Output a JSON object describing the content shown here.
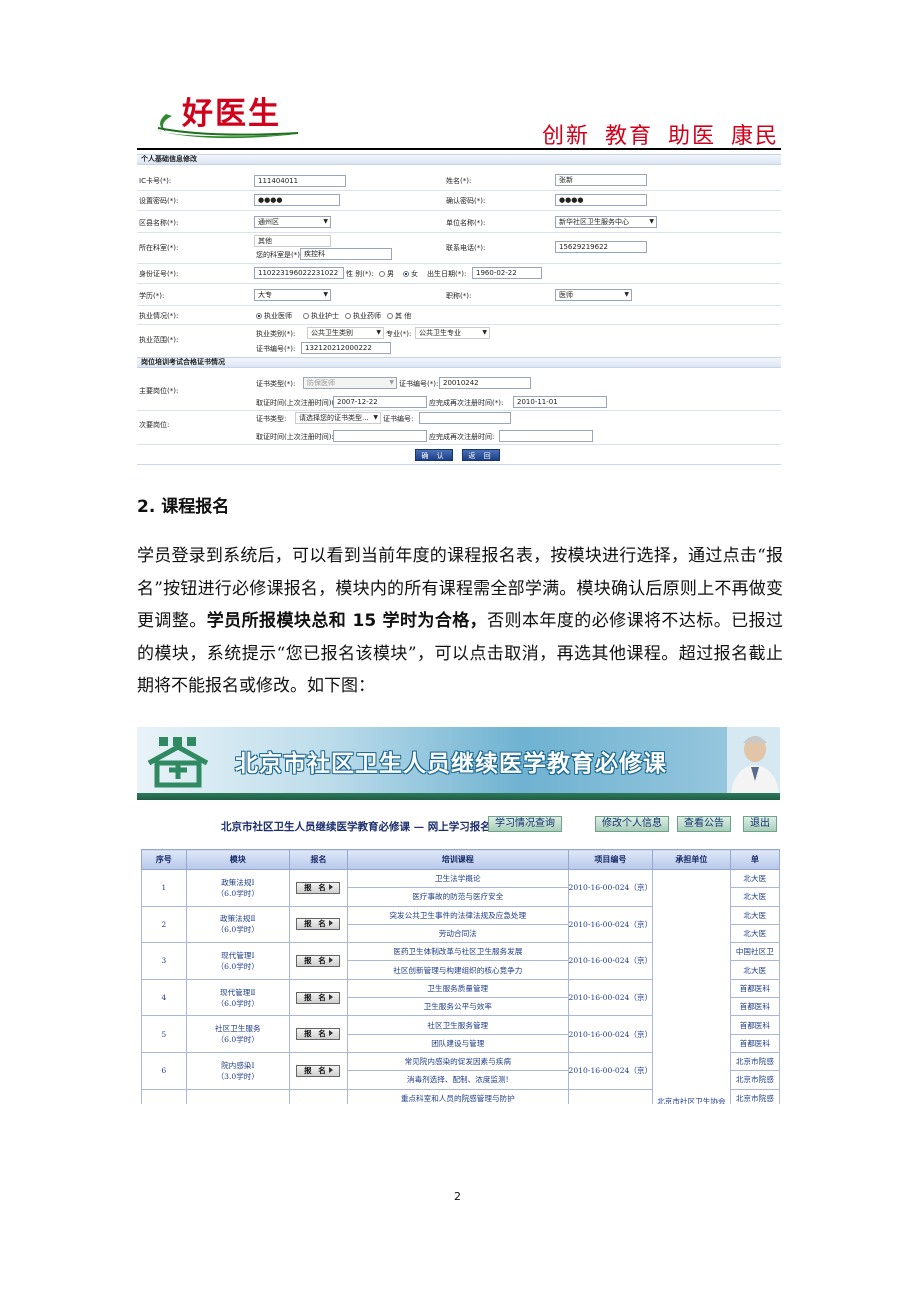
{
  "header": {
    "logo_text": "好医生",
    "slogan": "创新 教育 助医 康民"
  },
  "form": {
    "section1_title": "个人基础信息修改",
    "ic_label": "IC卡号(*):",
    "ic_value": "111404011",
    "name_label": "姓名(*):",
    "name_value": "张新",
    "pwd_label": "设置密码(*):",
    "pwd_value": "●●●●",
    "confirm_label": "确认密码(*):",
    "confirm_value": "●●●●",
    "district_label": "区县名称(*):",
    "district_value": "通州区",
    "unit_label": "单位名称(*):",
    "unit_value": "新华社区卫生服务中心",
    "dept_label": "所在科室(*):",
    "dept_value": "其他",
    "dept_note_label": "您的科室是(*):",
    "dept_note_value": "疾控科",
    "phone_label": "联系电话(*):",
    "phone_value": "15629219622",
    "id_label": "身份证号(*):",
    "id_value": "110223196022231022",
    "gender_label": "性 别(*):",
    "gender_male": "男",
    "gender_female": "女",
    "birth_label": "出生日期(*):",
    "birth_value": "1960-02-22",
    "edu_label": "学历(*):",
    "edu_value": "大专",
    "title_label": "职称(*):",
    "title_value": "医师",
    "practice_label": "执业情况(*):",
    "practice_opts": [
      "执业医师",
      "执业护士",
      "执业药师",
      "其 他"
    ],
    "scope_label": "执业范围(*):",
    "scope_cat_label": "执业类别(*):",
    "scope_cat_value": "公共卫生类别",
    "scope_spec_label": "专业(*):",
    "scope_spec_value": "公共卫生专业",
    "cert_no_label": "证书编号(*):",
    "cert_no_value": "132120212000222",
    "section2_title": "岗位培训考试合格证书情况",
    "main_post_label": "主要岗位(*):",
    "cert_type_label": "证书类型(*):",
    "cert_type_value": "防保医师",
    "cert_num_label": "证书编号(*):",
    "cert_num_value": "20010242",
    "issue_label": "取证时间(上次注册时间)(*):",
    "issue_value": "2007-12-22",
    "renew_label": "应完成再次注册时间(*):",
    "renew_value": "2010-11-01",
    "sub_post_label": "次要岗位:",
    "sub_cert_type_label": "证书类型:",
    "sub_cert_type_value": "请选择您的证书类型...",
    "sub_cert_num_label": "证书编号:",
    "sub_issue_label": "取证时间(上次注册时间):",
    "sub_renew_label": "应完成再次注册时间:",
    "confirm_btn": "确 认",
    "back_btn": "返 回"
  },
  "heading": "2.  课程报名",
  "paragraph": {
    "part1": "学员登录到系统后，可以看到当前年度的课程报名表，按模块进行选择，通过点击“报名”按钮进行必修课报名，模块内的所有课程需全部学满。模块确认后原则上不再做变更调整。",
    "bold": "学员所报模块总和 15 学时为合格，",
    "part2": "否则本年度的必修课将不达标。已报过的模块，系统提示“您已报名该模块”，可以点击取消，再选其他课程。超过报名截止期将不能报名或修改。如下图："
  },
  "course_page": {
    "banner_title": "北京市社区卫生人员继续医学教育必修课",
    "subnav_title": "北京市社区卫生人员继续医学教育必修课 — 网上学习报名",
    "nav_buttons": [
      "学习情况查询",
      "修改个人信息",
      "查看公告",
      "退出"
    ],
    "columns": [
      "序号",
      "模块",
      "报名",
      "培训课程",
      "项目编号",
      "承担单位",
      "单"
    ],
    "signup_label": "报 名",
    "rows": [
      {
        "no": "1",
        "module": "政策法规Ⅰ",
        "hours": "（6.0学时）",
        "courses": [
          "卫生法学概论",
          "医疗事故的防范与医疗安全"
        ],
        "code": "2010-16-00-024（京）",
        "units": [
          "北大医",
          "北大医"
        ]
      },
      {
        "no": "2",
        "module": "政策法规Ⅱ",
        "hours": "（6.0学时）",
        "courses": [
          "突发公共卫生事件的法律法规及应急处理",
          "劳动合同法"
        ],
        "code": "2010-16-00-024（京）",
        "units": [
          "北大医",
          "北大医"
        ]
      },
      {
        "no": "3",
        "module": "现代管理Ⅰ",
        "hours": "（6.0学时）",
        "courses": [
          "医药卫生体制改革与社区卫生服务发展",
          "社区创新管理与构建组织的核心竞争力"
        ],
        "code": "2010-16-00-024（京）",
        "units": [
          "中国社区卫",
          "北大医"
        ]
      },
      {
        "no": "4",
        "module": "现代管理Ⅱ",
        "hours": "（6.0学时）",
        "courses": [
          "卫生服务质量管理",
          "卫生服务公平与效率"
        ],
        "code": "2010-16-00-024（京）",
        "units": [
          "首都医科",
          "首都医科"
        ]
      },
      {
        "no": "5",
        "module": "社区卫生服务",
        "hours": "（6.0学时）",
        "courses": [
          "社区卫生服务管理",
          "团队建设与管理"
        ],
        "code": "2010-16-00-024（京）",
        "units": [
          "首都医科",
          "首都医科"
        ]
      },
      {
        "no": "6",
        "module": "院内感染Ⅰ",
        "hours": "（3.0学时）",
        "courses": [
          "常见院内感染的促发因素与疾病",
          "消毒剂选择、配制、浓度监测!"
        ],
        "code": "2010-16-00-024（京）",
        "units": [
          "北京市院感",
          "北京市院感"
        ]
      },
      {
        "no": "",
        "module": "",
        "hours": "",
        "courses": [
          "重点科室和人员的院感管理与防护"
        ],
        "code": "",
        "units": [
          "北京市院感"
        ]
      }
    ],
    "unit_merged": "北京市社区卫生协会"
  },
  "page_number": "2"
}
